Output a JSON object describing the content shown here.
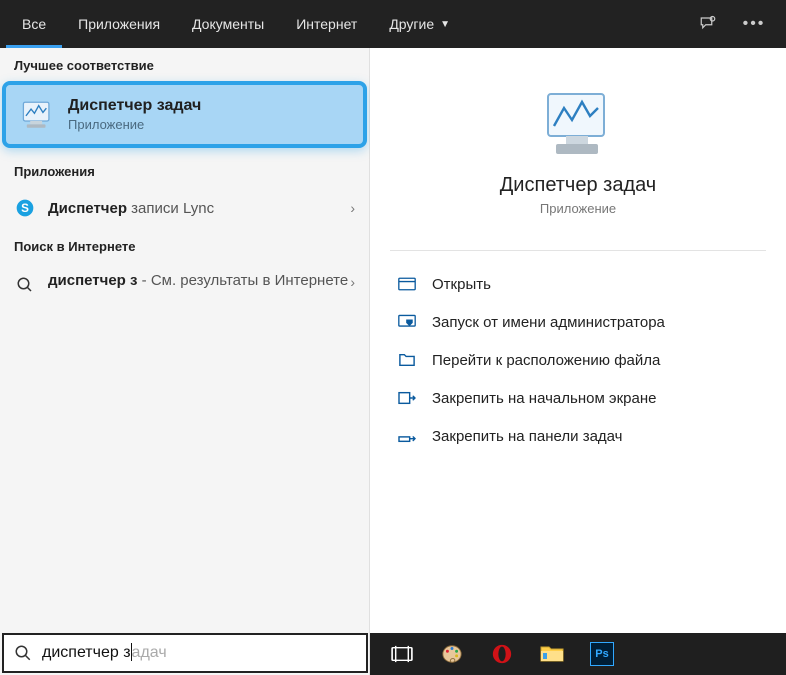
{
  "header": {
    "tabs": [
      {
        "label": "Все",
        "active": true
      },
      {
        "label": "Приложения",
        "active": false
      },
      {
        "label": "Документы",
        "active": false
      },
      {
        "label": "Интернет",
        "active": false
      },
      {
        "label": "Другие",
        "active": false,
        "dropdown": true
      }
    ],
    "feedback_icon": "feedback-icon",
    "overflow_icon": "more-icon"
  },
  "left": {
    "best_match_header": "Лучшее соответствие",
    "best_match": {
      "title": "Диспетчер задач",
      "subtitle": "Приложение",
      "icon": "task-manager-icon"
    },
    "apps_header": "Приложения",
    "apps": [
      {
        "icon": "skype-icon",
        "label_match": "Диспетчер",
        "label_rest": " записи Lync",
        "has_chevron": true
      }
    ],
    "web_header": "Поиск в Интернете",
    "web": [
      {
        "icon": "search-icon",
        "label_match": "диспетчер з",
        "label_rest": " - ",
        "subcontinue": "См. результаты в Интернете",
        "has_chevron": true
      }
    ]
  },
  "right": {
    "title": "Диспетчер задач",
    "subtitle": "Приложение",
    "actions": [
      {
        "icon": "open-icon",
        "label": "Открыть"
      },
      {
        "icon": "shield-icon",
        "label": "Запуск от имени администратора"
      },
      {
        "icon": "folder-open-icon",
        "label": "Перейти к расположению файла"
      },
      {
        "icon": "pin-start-icon",
        "label": "Закрепить на начальном экране"
      },
      {
        "icon": "pin-taskbar-icon",
        "label": "Закрепить на панели задач"
      }
    ]
  },
  "search": {
    "typed": "диспетчер з",
    "completion": "адач"
  },
  "taskbar": {
    "items": [
      {
        "name": "task-view-icon",
        "type": "taskview"
      },
      {
        "name": "paint-icon",
        "type": "paint"
      },
      {
        "name": "opera-icon",
        "type": "opera"
      },
      {
        "name": "file-explorer-icon",
        "type": "explorer"
      },
      {
        "name": "photoshop-icon",
        "type": "ps",
        "label": "Ps"
      }
    ]
  }
}
